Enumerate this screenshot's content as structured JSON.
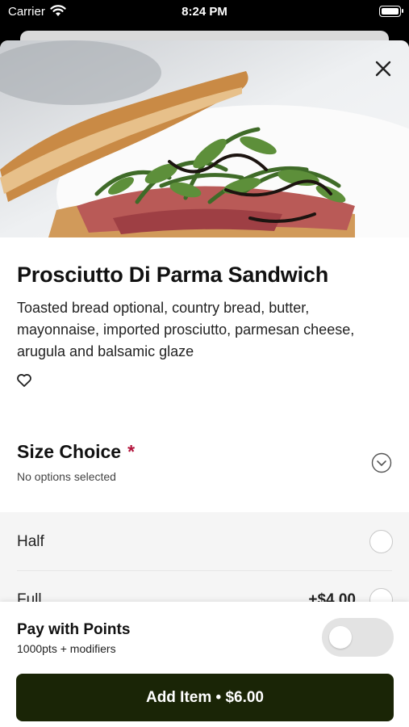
{
  "status_bar": {
    "carrier": "Carrier",
    "time": "8:24 PM"
  },
  "item": {
    "title": "Prosciutto Di Parma Sandwich",
    "description": "Toasted bread optional, country bread, butter, mayonnaise, imported prosciutto, parmesan cheese, arugula and balsamic glaze"
  },
  "modifier_group": {
    "title": "Size Choice",
    "required_mark": "*",
    "subtitle": "No options selected",
    "options": [
      {
        "label": "Half",
        "price": ""
      },
      {
        "label": "Full",
        "price": "+$4.00"
      }
    ]
  },
  "bottom": {
    "pay_title": "Pay with Points",
    "pay_subtitle": "1000pts + modifiers",
    "add_button_label": "Add Item • $6.00"
  },
  "colors": {
    "accent": "#b3143c",
    "button_bg": "#1a2506"
  }
}
